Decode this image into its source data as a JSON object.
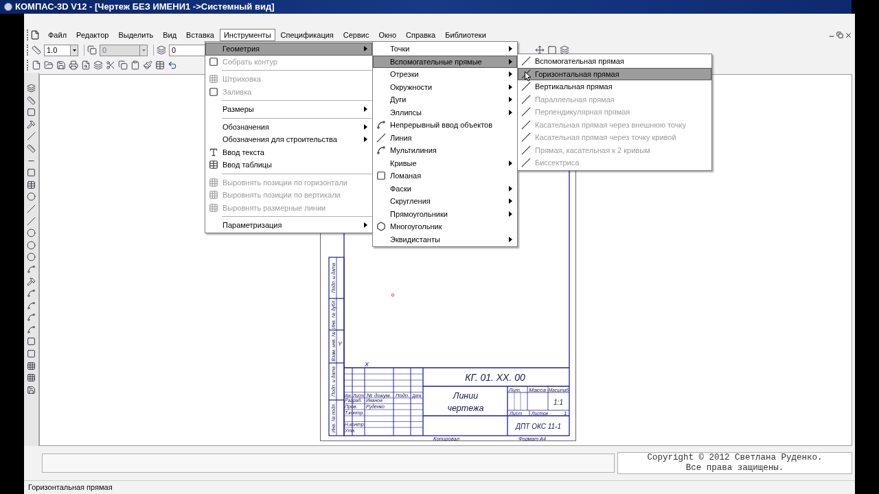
{
  "window": {
    "title": "КОМПАС-3D V12 - [Чертеж БЕЗ ИМЕНИ1 ->Системный вид]"
  },
  "menu_bar": [
    {
      "label": "Файл",
      "selected": false
    },
    {
      "label": "Редактор",
      "selected": false
    },
    {
      "label": "Выделить",
      "selected": false
    },
    {
      "label": "Вид",
      "selected": false
    },
    {
      "label": "Вставка",
      "selected": false
    },
    {
      "label": "Инструменты",
      "selected": true
    },
    {
      "label": "Спецификация",
      "selected": false
    },
    {
      "label": "Сервис",
      "selected": false
    },
    {
      "label": "Окно",
      "selected": false
    },
    {
      "label": "Справка",
      "selected": false
    },
    {
      "label": "Библиотеки",
      "selected": false
    }
  ],
  "toolbar": {
    "line_scale": "1.0",
    "layer_combo": "0",
    "layer_field": "0"
  },
  "menus": [
    {
      "items": [
        {
          "kind": "submenu",
          "label": "Геометрия",
          "selected": true,
          "disabled": false
        },
        {
          "kind": "command",
          "label": "Собрать контур",
          "selected": false,
          "disabled": true
        },
        {
          "kind": "separator"
        },
        {
          "kind": "command",
          "label": "Штриховка",
          "selected": false,
          "disabled": true
        },
        {
          "kind": "command",
          "label": "Заливка",
          "selected": false,
          "disabled": true
        },
        {
          "kind": "separator"
        },
        {
          "kind": "submenu",
          "label": "Размеры",
          "selected": false,
          "disabled": false
        },
        {
          "kind": "separator"
        },
        {
          "kind": "submenu",
          "label": "Обозначения",
          "selected": false,
          "disabled": false
        },
        {
          "kind": "submenu",
          "label": "Обозначения для строительства",
          "selected": false,
          "disabled": false
        },
        {
          "kind": "command",
          "label": "Ввод текста",
          "selected": false,
          "disabled": false
        },
        {
          "kind": "command",
          "label": "Ввод таблицы",
          "selected": false,
          "disabled": false
        },
        {
          "kind": "separator"
        },
        {
          "kind": "command",
          "label": "Выровнять позиции по горизонтали",
          "selected": false,
          "disabled": true
        },
        {
          "kind": "command",
          "label": "Выровнять позиции по вертикали",
          "selected": false,
          "disabled": true
        },
        {
          "kind": "command",
          "label": "Выровнять размерные линии",
          "selected": false,
          "disabled": true
        },
        {
          "kind": "separator"
        },
        {
          "kind": "submenu",
          "label": "Параметризация",
          "selected": false,
          "disabled": false
        }
      ]
    },
    {
      "items": [
        {
          "kind": "submenu",
          "label": "Точки",
          "selected": false,
          "disabled": false
        },
        {
          "kind": "submenu",
          "label": "Вспомогательные прямые",
          "selected": true,
          "disabled": false
        },
        {
          "kind": "submenu",
          "label": "Отрезки",
          "selected": false,
          "disabled": false
        },
        {
          "kind": "submenu",
          "label": "Окружности",
          "selected": false,
          "disabled": false
        },
        {
          "kind": "submenu",
          "label": "Дуги",
          "selected": false,
          "disabled": false
        },
        {
          "kind": "submenu",
          "label": "Эллипсы",
          "selected": false,
          "disabled": false
        },
        {
          "kind": "command",
          "label": "Непрерывный ввод объектов",
          "selected": false,
          "disabled": false
        },
        {
          "kind": "command",
          "label": "Линия",
          "selected": false,
          "disabled": false
        },
        {
          "kind": "command",
          "label": "Мультилиния",
          "selected": false,
          "disabled": false
        },
        {
          "kind": "submenu",
          "label": "Кривые",
          "selected": false,
          "disabled": false
        },
        {
          "kind": "command",
          "label": "Ломаная",
          "selected": false,
          "disabled": false
        },
        {
          "kind": "submenu",
          "label": "Фаски",
          "selected": false,
          "disabled": false
        },
        {
          "kind": "submenu",
          "label": "Скругления",
          "selected": false,
          "disabled": false
        },
        {
          "kind": "submenu",
          "label": "Прямоугольники",
          "selected": false,
          "disabled": false
        },
        {
          "kind": "command",
          "label": "Многоугольник",
          "selected": false,
          "disabled": false
        },
        {
          "kind": "submenu",
          "label": "Эквидистанты",
          "selected": false,
          "disabled": false
        }
      ]
    },
    {
      "items": [
        {
          "kind": "command",
          "label": "Вспомогательная прямая",
          "selected": false,
          "disabled": false
        },
        {
          "kind": "command",
          "label": "Горизонтальная прямая",
          "selected": true,
          "disabled": false
        },
        {
          "kind": "command",
          "label": "Вертикальная прямая",
          "selected": false,
          "disabled": false
        },
        {
          "kind": "command",
          "label": "Параллельная прямая",
          "selected": false,
          "disabled": true
        },
        {
          "kind": "command",
          "label": "Перпендикулярная прямая",
          "selected": false,
          "disabled": true
        },
        {
          "kind": "command",
          "label": "Касательная прямая через внешнюю точку",
          "selected": false,
          "disabled": true
        },
        {
          "kind": "command",
          "label": "Касательная прямая через точку кривой",
          "selected": false,
          "disabled": true
        },
        {
          "kind": "command",
          "label": "Прямая, касательная к 2 кривым",
          "selected": false,
          "disabled": true
        },
        {
          "kind": "command",
          "label": "Биссектриса",
          "selected": false,
          "disabled": true
        }
      ]
    }
  ],
  "drawing": {
    "side_labels": [
      "Подп. и дата",
      "Инв. № дубл.",
      "Взам. инв. №",
      "Подп. и дата",
      "Инв. № подл."
    ],
    "axis_labels": [
      "Y",
      "X"
    ],
    "title_block": {
      "designation": "КГ. 01. ХХ. 00",
      "name": [
        "Линии",
        "чертежа"
      ],
      "organization": "ДПТ ОКС 11-1",
      "scale": "1:1",
      "change_headers": [
        "Изм.",
        "Лист",
        "№ докум.",
        "Подп.",
        "Дата"
      ],
      "roles": [
        {
          "role": "Разраб.",
          "name": "Иванов"
        },
        {
          "role": "Пров.",
          "name": "Руденко"
        },
        {
          "role": "Т.контр."
        },
        {
          "role": "Н.контр."
        },
        {
          "role": "Утв."
        }
      ],
      "column_headers": [
        "Лит.",
        "Масса",
        "Масштаб"
      ],
      "sheet_label": "Лист",
      "sheets_label": "Листов",
      "sheets_count": "1"
    },
    "copied": "Копировал",
    "format": "Формат А4"
  },
  "copyright": [
    "Copyright © 2012 Светлана Руденко.",
    "Все права защищены."
  ],
  "status_bar": "Горизонтальная прямая"
}
